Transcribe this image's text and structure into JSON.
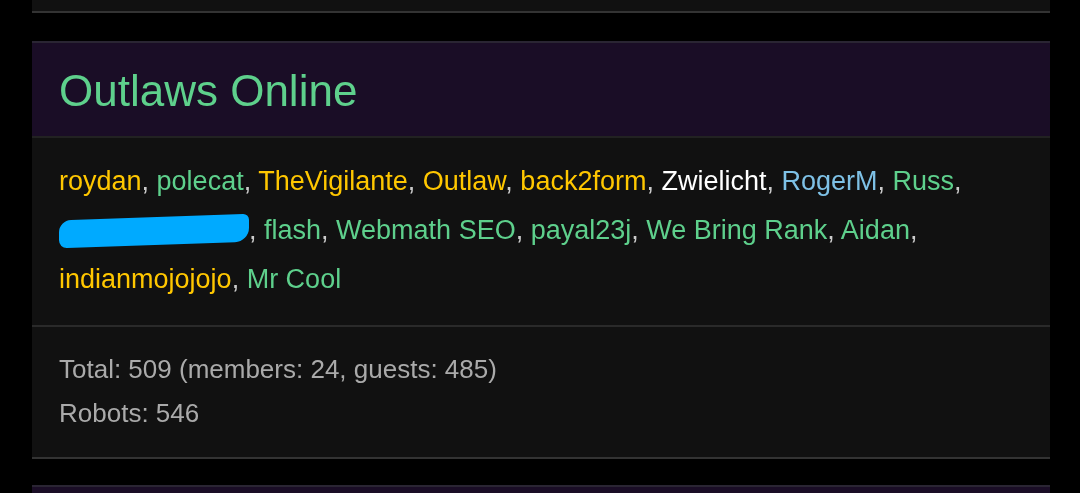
{
  "panel": {
    "title": "Outlaws Online",
    "separator": ", ",
    "users": [
      {
        "kind": "user",
        "name": "roydan",
        "color": "#ffc700"
      },
      {
        "kind": "user",
        "name": "polecat",
        "color": "#5ed08c"
      },
      {
        "kind": "user",
        "name": "TheVigilante",
        "color": "#ffc700"
      },
      {
        "kind": "user",
        "name": "Outlaw",
        "color": "#ffc700"
      },
      {
        "kind": "user",
        "name": "back2form",
        "color": "#ffc700"
      },
      {
        "kind": "user",
        "name": "Zwielicht",
        "color": "#ffffff"
      },
      {
        "kind": "user",
        "name": "RogerM",
        "color": "#7ec1e6"
      },
      {
        "kind": "user",
        "name": "Russ",
        "color": "#5ed08c"
      },
      {
        "kind": "redacted"
      },
      {
        "kind": "user",
        "name": "flash",
        "color": "#5ed08c"
      },
      {
        "kind": "user",
        "name": "Webmath SEO",
        "color": "#5ed08c"
      },
      {
        "kind": "user",
        "name": "payal23j",
        "color": "#5ed08c"
      },
      {
        "kind": "user",
        "name": "We Bring Rank",
        "color": "#5ed08c"
      },
      {
        "kind": "user",
        "name": "Aidan",
        "color": "#5ed08c"
      },
      {
        "kind": "user",
        "name": "indianmojojojo",
        "color": "#ffc700"
      },
      {
        "kind": "user",
        "name": "Mr Cool",
        "color": "#5ed08c"
      }
    ],
    "stats": [
      "Total: 509 (members: 24, guests: 485)",
      "Robots: 546"
    ]
  }
}
